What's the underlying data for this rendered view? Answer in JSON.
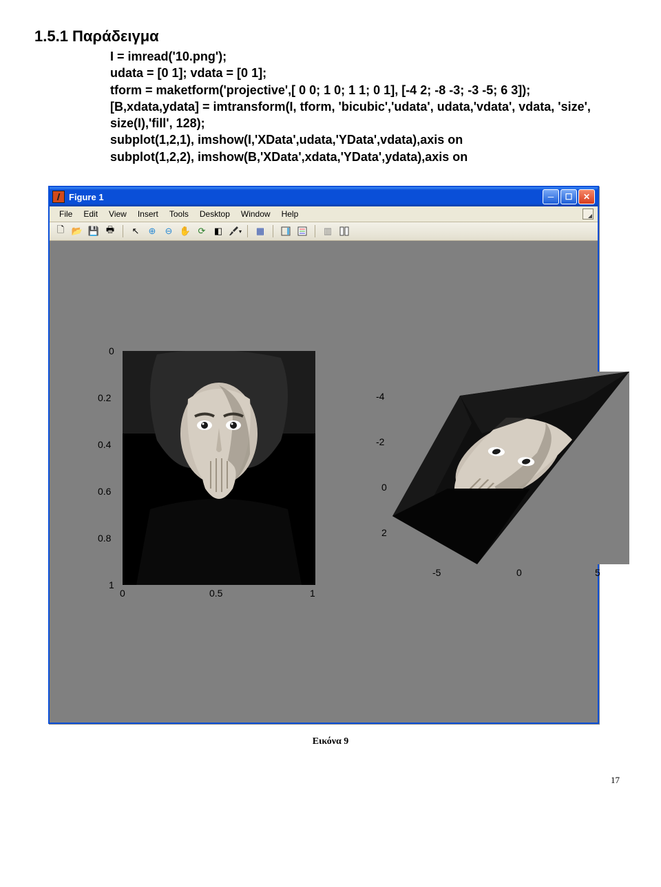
{
  "heading": "1.5.1 Παράδειγμα",
  "code": {
    "l1": "I = imread('10.png');",
    "l2": "udata = [0 1];  vdata = [0 1];",
    "l3": "tform = maketform('projective',[ 0 0;  1  0;  1  1; 0 1], [-4 2; -8 -3; -3 -5; 6 3]);",
    "l4": "[B,xdata,ydata] = imtransform(I, tform, 'bicubic','udata', udata,'vdata', vdata, 'size', size(I),'fill', 128);",
    "l5": "subplot(1,2,1), imshow(I,'XData',udata,'YData',vdata),axis on",
    "l6": "subplot(1,2,2), imshow(B,'XData',xdata,'YData',ydata),axis on"
  },
  "figure": {
    "title": "Figure 1",
    "menu": [
      "File",
      "Edit",
      "View",
      "Insert",
      "Tools",
      "Desktop",
      "Window",
      "Help"
    ],
    "toolbar_icons": [
      "new-doc",
      "open",
      "save",
      "print",
      "arrow",
      "zoom-in",
      "zoom-out",
      "pan",
      "rotate",
      "data-cursor",
      "brush",
      "link",
      "colorbar",
      "insert-legend",
      "hide-toolbar",
      "show-toolbar"
    ],
    "left_plot": {
      "yticks": [
        "0",
        "0.2",
        "0.4",
        "0.6",
        "0.8",
        "1"
      ],
      "xticks": [
        "0",
        "0.5",
        "1"
      ]
    },
    "right_plot": {
      "yticks": [
        "-4",
        "-2",
        "0",
        "2"
      ],
      "xticks": [
        "-5",
        "0",
        "5"
      ]
    }
  },
  "caption": "Εικόνα 9",
  "pagenum": "17"
}
